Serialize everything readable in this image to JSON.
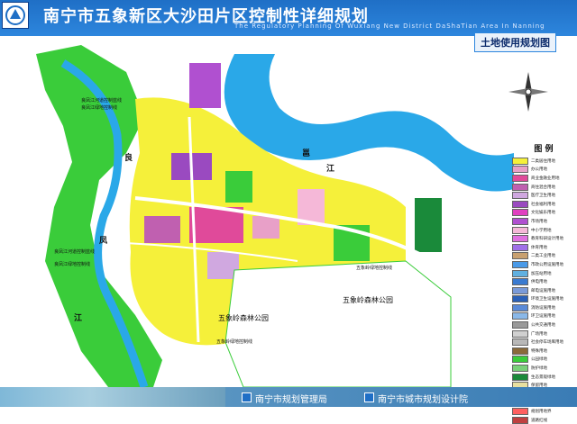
{
  "header": {
    "title": "南宁市五象新区大沙田片区控制性详细规划",
    "subtitle": "The Regulatory Planning Of Wuxiang New District DaShaTian Area In Nanning"
  },
  "sheet_title": "土地使用规划图",
  "map_labels": {
    "river_1": "邕",
    "river_2": "江",
    "river_3": "良",
    "river_4": "凤",
    "river_5": "江",
    "park_1": "五象岭森林公园",
    "park_2": "五象岭森林公园",
    "ctrl_1": "良凤江河道控制蓝线",
    "ctrl_2": "良凤江绿地控制线",
    "ctrl_3": "良凤江河道控制蓝线",
    "ctrl_4": "良凤江绿地控制线",
    "ctrl_5": "五象岭绿地控制线",
    "ctrl_6": "五象岭绿地控制线"
  },
  "legend": {
    "title": "图 例",
    "items": [
      {
        "label": "二类居住用地",
        "color": "#f5f03a"
      },
      {
        "label": "办公用地",
        "color": "#e8a0c8"
      },
      {
        "label": "商业金融业用地",
        "color": "#e04a9a"
      },
      {
        "label": "商住混合用地",
        "color": "#c060b0"
      },
      {
        "label": "医疗卫生用地",
        "color": "#d0a8e0"
      },
      {
        "label": "社会福利用地",
        "color": "#9a4ac0"
      },
      {
        "label": "文化娱乐用地",
        "color": "#e040c0"
      },
      {
        "label": "市场用地",
        "color": "#b050d0"
      },
      {
        "label": "中小学用地",
        "color": "#f5b8d8"
      },
      {
        "label": "教育科研设计用地",
        "color": "#e070e0"
      },
      {
        "label": "体育用地",
        "color": "#a070e8"
      },
      {
        "label": "二类工业用地",
        "color": "#c8a070"
      },
      {
        "label": "市政公用设施用地",
        "color": "#4a9ae8"
      },
      {
        "label": "加压站用地",
        "color": "#60b0e0"
      },
      {
        "label": "供电用地",
        "color": "#3a7ad0"
      },
      {
        "label": "邮电设施用地",
        "color": "#7a9ad8"
      },
      {
        "label": "环境卫生设施用地",
        "color": "#2a60b8"
      },
      {
        "label": "消防设施用地",
        "color": "#5a8ad8"
      },
      {
        "label": "环卫设施用地",
        "color": "#8ab8e8"
      },
      {
        "label": "公共交通用地",
        "color": "#9a9a9a"
      },
      {
        "label": "广场用地",
        "color": "#d0d0d0"
      },
      {
        "label": "社会停车场库用地",
        "color": "#b8b8b8"
      },
      {
        "label": "特殊用地",
        "color": "#8a6a3a"
      },
      {
        "label": "公园绿地",
        "color": "#3acc3a"
      },
      {
        "label": "防护绿地",
        "color": "#7ad07a"
      },
      {
        "label": "生态景观绿地",
        "color": "#1a8a3a"
      },
      {
        "label": "保留用地",
        "color": "#e8e0a0"
      },
      {
        "label": "水域",
        "color": "#2aa8e8"
      },
      {
        "label": "规划路网",
        "color": "#ffffff"
      },
      {
        "label": "规划用地界",
        "color": "#ff6060"
      },
      {
        "label": "道路红线",
        "color": "#c04040"
      }
    ]
  },
  "footer": {
    "org_1": "南宁市规划管理局",
    "org_2": "南宁市城市规划设计院"
  }
}
